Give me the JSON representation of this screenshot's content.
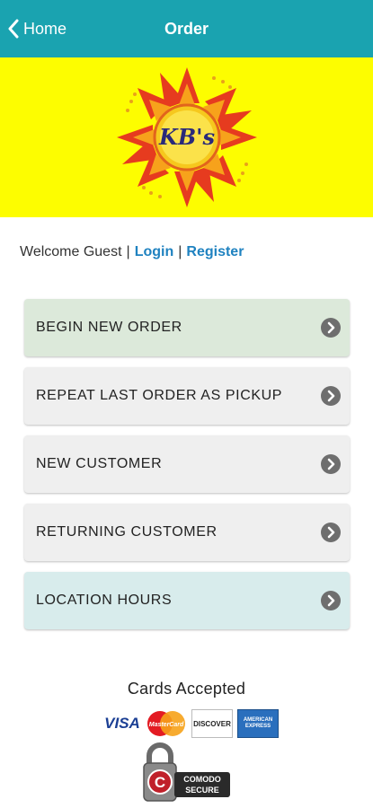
{
  "header": {
    "back_label": "Home",
    "title": "Order"
  },
  "brand": {
    "logo_text": "KB's",
    "banner_color": "#fdfd00",
    "header_color": "#1aa3b0"
  },
  "welcome": {
    "text": "Welcome Guest",
    "separator": "|",
    "login": "Login",
    "register": "Register"
  },
  "menu": {
    "items": [
      {
        "label": "BEGIN NEW ORDER"
      },
      {
        "label": "REPEAT LAST ORDER AS PICKUP"
      },
      {
        "label": "NEW CUSTOMER"
      },
      {
        "label": "RETURNING CUSTOMER"
      },
      {
        "label": "LOCATION HOURS"
      }
    ]
  },
  "footer": {
    "cards_title": "Cards Accepted",
    "cards": {
      "visa": "VISA",
      "mastercard": "MasterCard",
      "discover": "DISCOVER",
      "amex_line1": "AMERICAN",
      "amex_line2": "EXPRESS"
    },
    "badge_line1": "COMODO",
    "badge_line2": "SECURE"
  }
}
